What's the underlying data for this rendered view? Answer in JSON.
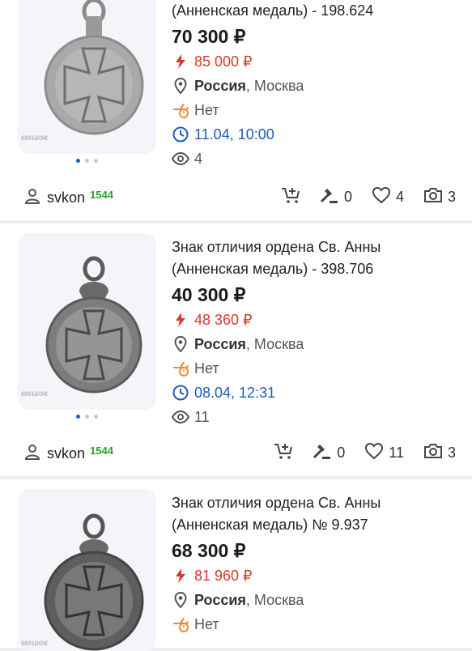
{
  "listings": [
    {
      "title_lines": [
        "",
        "(Анненская медаль) - 198.624"
      ],
      "price": "70 300 ₽",
      "blitz_price": "85 000 ₽",
      "region": "Россия",
      "city": "Москва",
      "shipping": "Нет",
      "end_time": "11.04, 10:00",
      "views": "4",
      "watermark": "мешок",
      "seller": "svkon",
      "seller_rating": "1544",
      "bids": "0",
      "favorites": "4",
      "photos": "3"
    },
    {
      "title_lines": [
        "Знак отличия ордена Св. Анны",
        "(Анненская медаль) - 398.706"
      ],
      "price": "40 300 ₽",
      "blitz_price": "48 360 ₽",
      "region": "Россия",
      "city": "Москва",
      "shipping": "Нет",
      "end_time": "08.04, 12:31",
      "views": "11",
      "watermark": "мешок",
      "seller": "svkon",
      "seller_rating": "1544",
      "bids": "0",
      "favorites": "11",
      "photos": "3"
    },
    {
      "title_lines": [
        "Знак отличия ордена Св. Анны",
        "(Анненская медаль) № 9.937"
      ],
      "price": "68 300 ₽",
      "blitz_price": "81 960 ₽",
      "region": "Россия",
      "city": "Москва",
      "shipping": "Нет",
      "end_time": "",
      "views": "",
      "watermark": "мешок",
      "seller": "",
      "seller_rating": "",
      "bids": "",
      "favorites": "",
      "photos": ""
    }
  ],
  "icons": {
    "blitz": "lightning-icon",
    "location": "location-pin-icon",
    "shipping": "no-shipping-icon",
    "time": "clock-icon",
    "views": "eye-icon",
    "seller": "user-icon",
    "cart": "add-to-cart-icon",
    "bids": "gavel-icon",
    "favorites": "heart-icon",
    "photos": "camera-icon"
  },
  "colors": {
    "price_blitz": "#d23b2e",
    "time": "#1f5bb8",
    "rating": "#27a12a",
    "shipping_icon": "#f08a3c"
  }
}
